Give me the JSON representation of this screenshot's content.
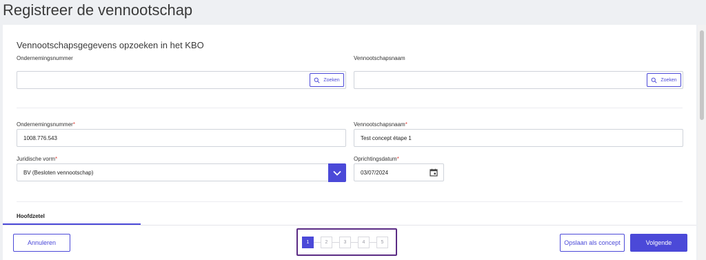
{
  "page": {
    "title": "Registreer de vennootschap"
  },
  "lookup": {
    "heading": "Vennootschapsgegevens opzoeken in het KBO",
    "enterprise_number_label": "Ondernemingsnummer",
    "enterprise_number_value": "",
    "company_name_label": "Vennootschapsnaam",
    "company_name_value": "",
    "search_label": "Zoeken"
  },
  "form": {
    "enterprise_number_label": "Ondernemingsnummer",
    "enterprise_number_value": "1008.776.543",
    "company_name_label": "Vennootschapsnaam",
    "company_name_value": "Test concept étape 1",
    "legal_form_label": "Juridische vorm",
    "legal_form_value": "BV (Besloten vennootschap)",
    "founding_date_label": "Oprichtingsdatum",
    "founding_date_value": "03/07/2024",
    "required_marker": "*"
  },
  "tabs": [
    {
      "label": "Hoofdzetel",
      "active": true
    }
  ],
  "footer": {
    "cancel_label": "Annuleren",
    "save_draft_label": "Opslaan als concept",
    "next_label": "Volgende"
  },
  "stepper": {
    "steps": [
      "1",
      "2",
      "3",
      "4",
      "5"
    ],
    "current": 1
  },
  "colors": {
    "accent": "#4b49d8",
    "highlight_frame": "#5b2b84",
    "required": "#e0413a",
    "background": "#eef0f3"
  },
  "icons": {
    "search": "search-icon",
    "dropdown": "chevron-down-icon",
    "calendar": "calendar-icon"
  }
}
